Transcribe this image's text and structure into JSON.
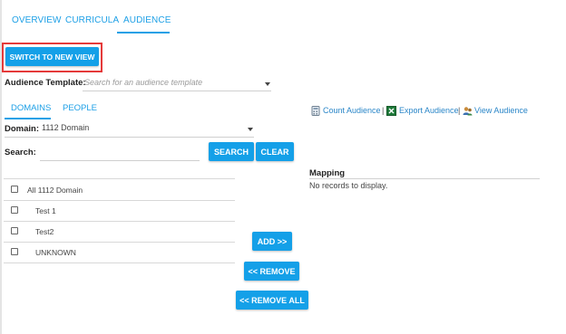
{
  "top_tabs": [
    "OVERVIEW",
    "CURRICULA",
    "AUDIENCE"
  ],
  "active_top_tab": "AUDIENCE",
  "switch_button": "SWITCH TO NEW VIEW",
  "audience_template": {
    "label": "Audience Template:",
    "placeholder": "Search for an audience template"
  },
  "sub_tabs": [
    "DOMAINS",
    "PEOPLE"
  ],
  "active_sub_tab": "DOMAINS",
  "domain": {
    "label": "Domain:",
    "value": "1112 Domain"
  },
  "search": {
    "label": "Search:",
    "value": ""
  },
  "buttons": {
    "search": "SEARCH",
    "clear": "CLEAR",
    "add": "ADD >>",
    "remove": "<< REMOVE",
    "remove_all": "<< REMOVE ALL"
  },
  "actions": {
    "count": "Count Audience",
    "export": "Export Audience",
    "view": "View Audience",
    "separator": "|"
  },
  "domain_list": [
    "All 1112 Domain",
    "Test 1",
    "Test2",
    "UNKNOWN"
  ],
  "mapping": {
    "header": "Mapping",
    "empty": "No records to display."
  },
  "colors": {
    "accent": "#14a0e8",
    "highlight_border": "#e53a3a",
    "link": "#2a86c8"
  }
}
